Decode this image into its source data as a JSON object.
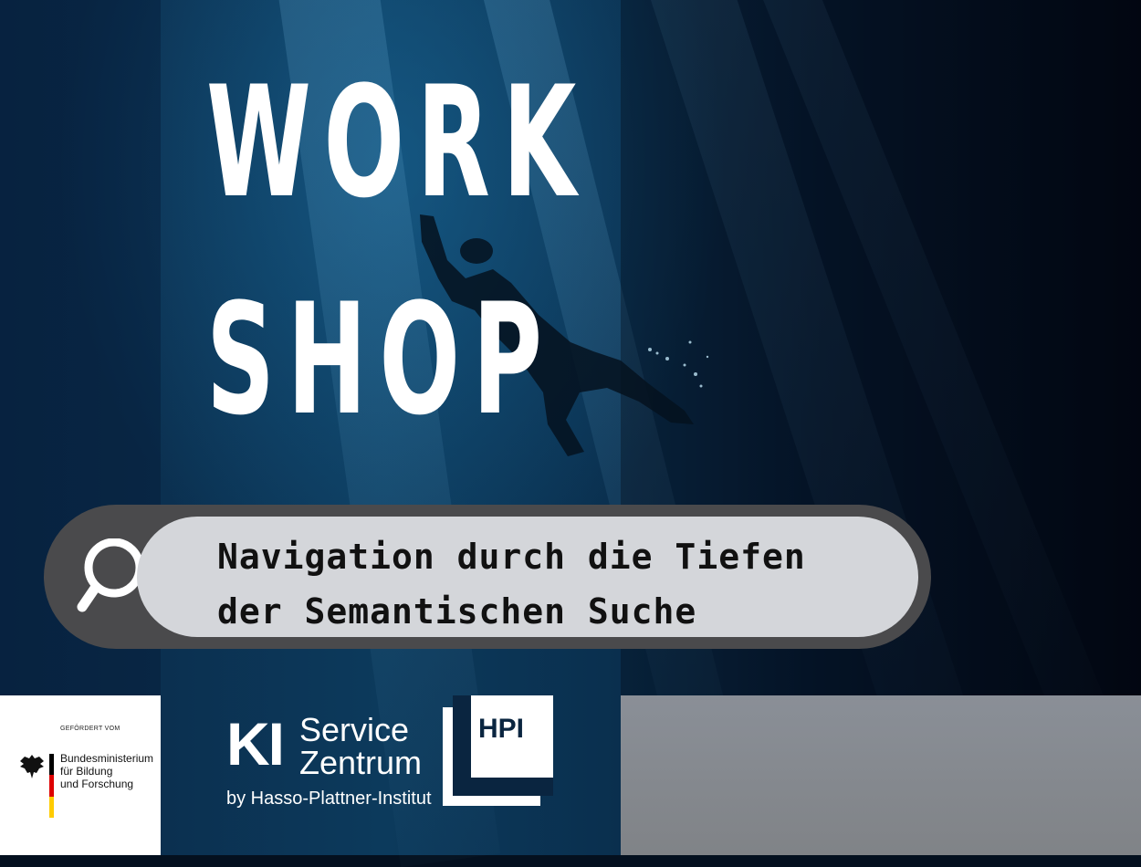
{
  "headline": {
    "line1": "WORK",
    "line2": "SHOP"
  },
  "search": {
    "line1": "Navigation durch die Tiefen",
    "line2": "der Semantischen Suche",
    "icon": "search-icon"
  },
  "bmbf": {
    "funded_by": "GEFÖRDERT VOM",
    "name_line1": "Bundesministerium",
    "name_line2": "für Bildung",
    "name_line3": "und Forschung"
  },
  "ki_service": {
    "abbr": "KI",
    "line1": "Service",
    "line2": "Zentrum",
    "byline": "by Hasso-Plattner-Institut"
  },
  "hpi": {
    "label": "HPI"
  },
  "colors": {
    "search_outer": "#4a4a4c",
    "search_inner": "#d4d6da",
    "text_dark": "#111111",
    "background": "#0a2a4a"
  }
}
